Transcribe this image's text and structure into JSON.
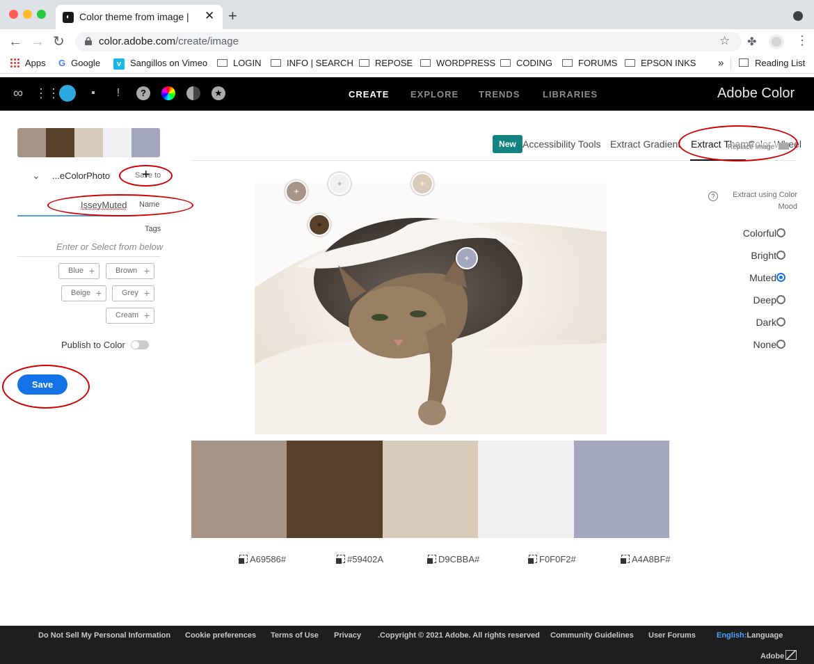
{
  "browser": {
    "tab_title": "Color theme from image | Adob",
    "url_host": "color.adobe.com",
    "url_path": "/create/image",
    "bookmarks": [
      "Apps",
      "Google",
      "Sangillos on Vimeo",
      "LOGIN",
      "INFO | SEARCH",
      "REPOSE",
      "WORDPRESS",
      "CODING",
      "FORUMS",
      "EPSON INKS"
    ],
    "overflow": "»",
    "reading_list": "Reading List"
  },
  "header": {
    "nav": [
      "CREATE",
      "EXPLORE",
      "TRENDS",
      "LIBRARIES"
    ],
    "brand": "Adobe Color"
  },
  "left_panel": {
    "library_name": "...eColorPhoto",
    "save_to": "Save to",
    "name_value": "IsseyMuted",
    "name_label": "Name",
    "tags_label": "Tags",
    "tags_placeholder": "Enter or Select from below",
    "tags": [
      "Blue",
      "Brown",
      "Beige",
      "Grey",
      "Cream"
    ],
    "publish_label": "Publish to Color",
    "save_button": "Save"
  },
  "tabs": {
    "new_badge": "New",
    "items": [
      "Accessibility Tools",
      "Extract Gradient",
      "Extract Theme",
      "Color Wheel"
    ],
    "replace_image": "Replace Image"
  },
  "extract": {
    "help": "?",
    "label": "Extract using Color Mood",
    "moods": [
      "Colorful",
      "Bright",
      "Muted",
      "Deep",
      "Dark",
      "None"
    ],
    "selected": "Muted"
  },
  "palette": {
    "colors": [
      "#A69586",
      "#59402A",
      "#D9CBBA",
      "#F0F0F2",
      "#A4A8BF"
    ],
    "hex_labels": [
      "A69586#",
      "#59402A",
      "D9CBBA#",
      "F0F0F2#",
      "A4A8BF#"
    ]
  },
  "footer": {
    "links": [
      "Do Not Sell My Personal Information",
      "Cookie preferences",
      "Terms of Use",
      "Privacy",
      ".Copyright © 2021 Adobe. All rights reserved",
      "Community Guidelines",
      "User Forums"
    ],
    "language_current": "English:",
    "language_label": "Language",
    "adobe": "Adobe"
  },
  "annotations": {
    "color": "#d40000"
  }
}
